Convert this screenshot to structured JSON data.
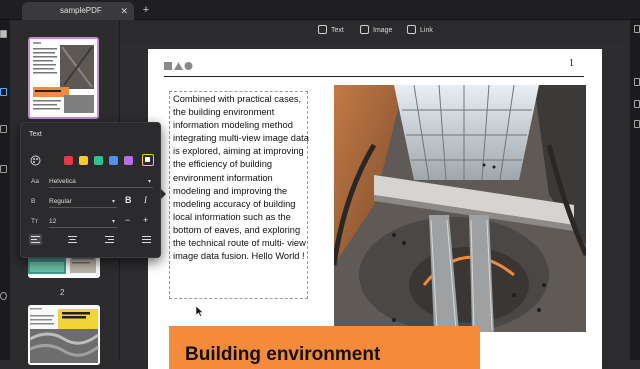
{
  "tabs": [
    {
      "title": "samplePDF",
      "close": "✕"
    }
  ],
  "tab_add": "+",
  "toolbar": {
    "text_label": "Text",
    "image_label": "Image",
    "link_label": "Link"
  },
  "thumbnails": {
    "page_label_2": "2"
  },
  "page": {
    "number": "1",
    "body_text": "Combined with practical cases, the building environment information modeling method integrating multi-view image data is explored, aiming at improving the efficiency of building environment information modeling and improving the modeling accuracy of building local information such as the bottom of eaves, and exploring the technical route of multi- view image data fusion. Hello World !",
    "heading": "Building environment"
  },
  "text_panel": {
    "title": "Text",
    "colors": [
      "#2b2b2b",
      "#e8364a",
      "#f5c830",
      "#2fc28e",
      "#4f8ff2",
      "#b46fe8",
      "#ffffff"
    ],
    "font_label": "Aa",
    "font_value": "Helvetica",
    "weight_label": "B",
    "weight_value": "Regular",
    "bold_label": "B",
    "italic_label": "I",
    "size_label": "Tт",
    "size_value": "12",
    "size_decrease": "−",
    "size_increase": "+",
    "alignments": [
      "left",
      "center",
      "right",
      "justify"
    ],
    "selected_alignment": "left"
  },
  "accent_colors": {
    "thumb_selected": "#c68ad6",
    "orange": "#f48a3b"
  }
}
